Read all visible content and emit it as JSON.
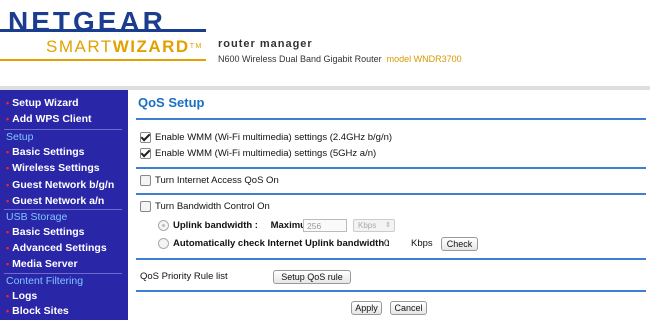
{
  "header": {
    "brand": "NETGEAR",
    "sub_smart": "SMART",
    "sub_wizard": "WIZARD",
    "sub_tm": "TM",
    "router_manager": "router manager",
    "router_desc": "N600 Wireless Dual Band Gigabit Router",
    "model": "model WNDR3700"
  },
  "sidebar": {
    "setup_wizard": "Setup Wizard",
    "add_wps": "Add WPS Client",
    "section_setup": "Setup",
    "basic_settings": "Basic Settings",
    "wireless_settings": "Wireless Settings",
    "guest_bg": "Guest Network b/g/n",
    "guest_a": "Guest Network a/n",
    "section_usb": "USB Storage",
    "usb_basic": "Basic Settings",
    "usb_advanced": "Advanced Settings",
    "media_server": "Media Server",
    "section_content": "Content Filtering",
    "logs": "Logs",
    "block_sites": "Block Sites"
  },
  "main": {
    "title": "QoS Setup",
    "wmm_24": "Enable WMM (Wi-Fi multimedia) settings (2.4GHz b/g/n)",
    "wmm_5": "Enable WMM (Wi-Fi multimedia) settings (5GHz a/n)",
    "internet_qos": "Turn Internet Access QoS On",
    "bandwidth_control": "Turn Bandwidth Control On",
    "uplink_label": "Uplink bandwidth :",
    "maximum_label": "Maximum",
    "uplink_value": "256",
    "uplink_unit": "Kbps",
    "auto_check_label": "Automatically check Internet Uplink bandwidth :",
    "auto_value": "0",
    "auto_unit": "Kbps",
    "check_button": "Check",
    "priority_label": "QoS Priority Rule list",
    "setup_rule_button": "Setup QoS rule",
    "apply_button": "Apply",
    "cancel_button": "Cancel"
  },
  "colors": {
    "brand_blue": "#1a3d8f",
    "brand_gold": "#e2a100",
    "sidebar_bg": "#2a26a8",
    "title_blue": "#1a6fc4"
  }
}
